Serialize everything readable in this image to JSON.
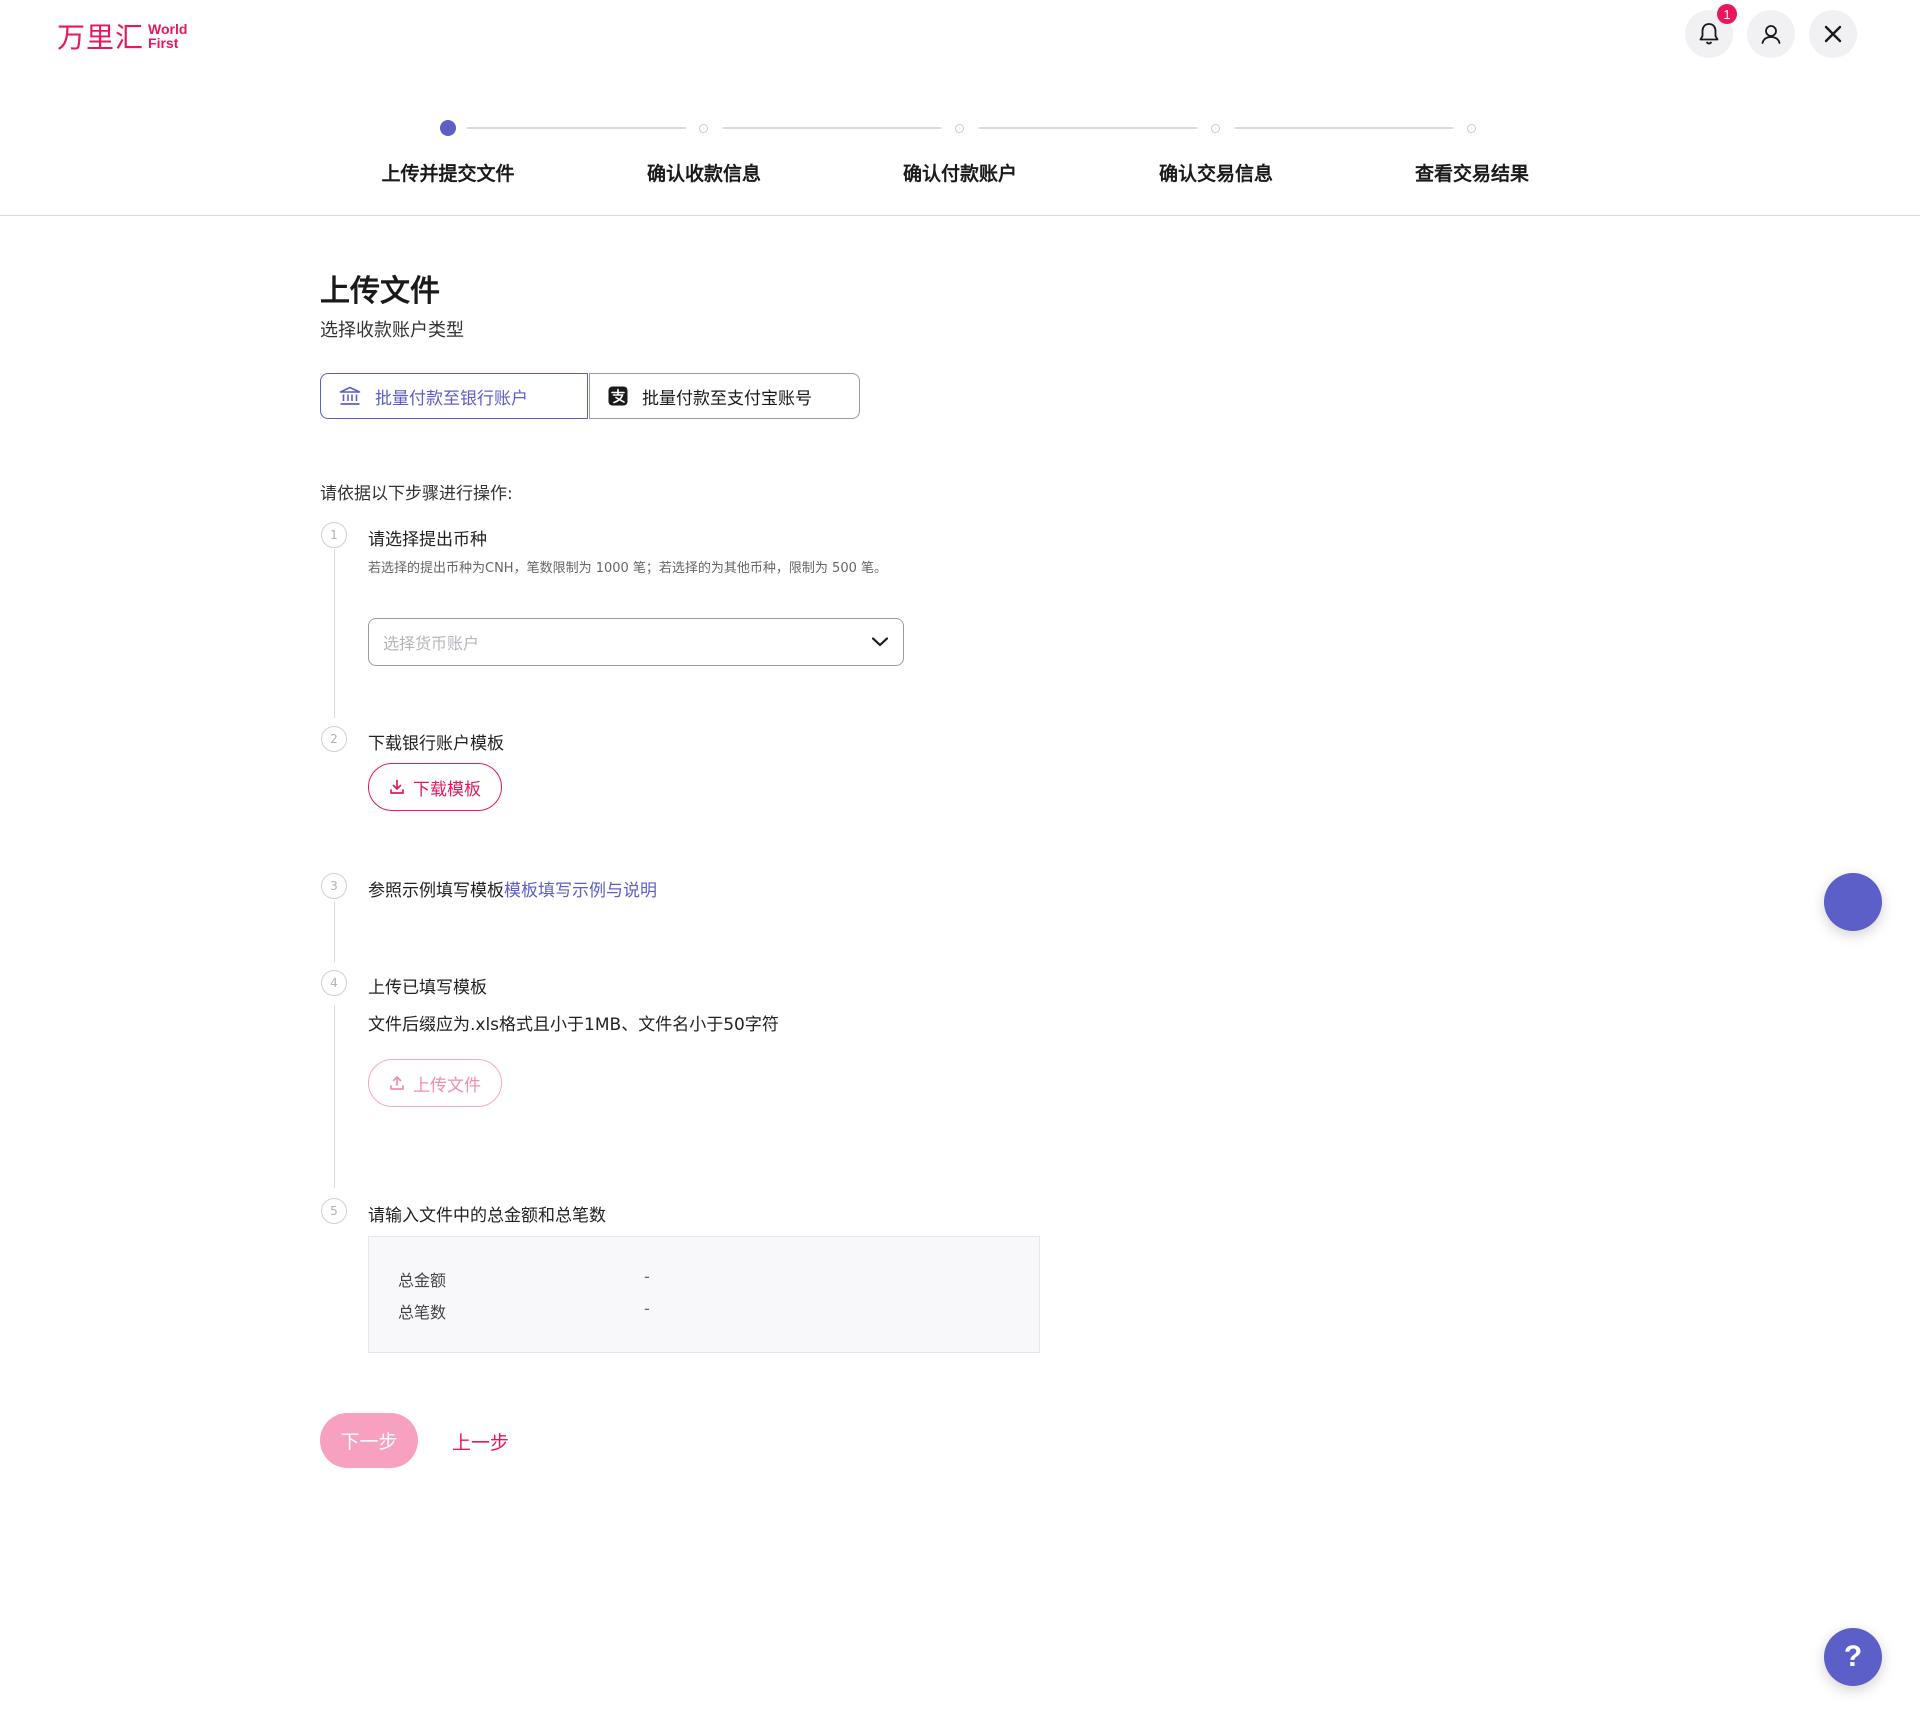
{
  "header": {
    "logo_cn": "万里汇",
    "logo_en_line1": "World",
    "logo_en_line2": "First",
    "notification_count": "1"
  },
  "stepper": {
    "steps": [
      {
        "label": "上传并提交文件",
        "active": true
      },
      {
        "label": "确认收款信息",
        "active": false
      },
      {
        "label": "确认付款账户",
        "active": false
      },
      {
        "label": "确认交易信息",
        "active": false
      },
      {
        "label": "查看交易结果",
        "active": false
      }
    ]
  },
  "main": {
    "title": "上传文件",
    "subtitle": "选择收款账户类型",
    "account_types": [
      {
        "label": "批量付款至银行账户",
        "selected": true,
        "icon": "bank-icon"
      },
      {
        "label": "批量付款至支付宝账号",
        "selected": false,
        "icon": "alipay-icon"
      }
    ],
    "instructions": "请依据以下步骤进行操作:",
    "steps": [
      {
        "num": "1",
        "title": "请选择提出币种",
        "hint": "若选择的提出币种为CNH，笔数限制为 1000 笔；若选择的为其他币种，限制为 500 笔。",
        "select_placeholder": "选择货币账户"
      },
      {
        "num": "2",
        "title": "下载银行账户模板",
        "button": "下载模板"
      },
      {
        "num": "3",
        "title": "参照示例填写模板",
        "link": "模板填写示例与说明"
      },
      {
        "num": "4",
        "title": "上传已填写模板",
        "desc": "文件后缀应为.xls格式且小于1MB、文件名小于50字符",
        "button": "上传文件"
      },
      {
        "num": "5",
        "title": "请输入文件中的总金额和总笔数",
        "summary": [
          {
            "label": "总金额",
            "value": "-"
          },
          {
            "label": "总笔数",
            "value": "-"
          }
        ]
      }
    ],
    "next_button": "下一步",
    "prev_button": "上一步"
  },
  "floating": {
    "help_label": "?"
  },
  "colors": {
    "brand_pink": "#e8175d",
    "accent_purple": "#5b5fc7"
  }
}
